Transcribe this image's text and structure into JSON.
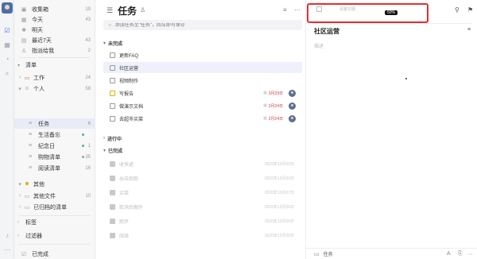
{
  "sidebar": {
    "smart_lists": [
      {
        "icon": "inbox-icon",
        "glyph": "▣",
        "label": "收集箱",
        "count": "19"
      },
      {
        "icon": "calendar-today-icon",
        "glyph": "▦",
        "label": "今天",
        "count": "43"
      },
      {
        "icon": "sun-icon",
        "glyph": "✺",
        "label": "明天",
        "count": ""
      },
      {
        "icon": "calendar-week-icon",
        "glyph": "▤",
        "label": "最近7天",
        "count": "43"
      },
      {
        "icon": "assigned-icon",
        "glyph": "♙",
        "label": "指派给我",
        "count": "2"
      }
    ],
    "lists_header": "清单",
    "folders": [
      {
        "label": "工作",
        "count": "24",
        "expanded": false,
        "icon": "folder-icon",
        "glyph": "▭"
      },
      {
        "label": "个人",
        "count": "58",
        "expanded": true,
        "icon": "person-emoji-icon",
        "glyph": "☺"
      }
    ],
    "personal_items": [
      {
        "label": "任务",
        "count": "6",
        "icon": "list-icon",
        "glyph": "≡",
        "selected": true,
        "dot": ""
      },
      {
        "label": "生活备忘",
        "count": "",
        "icon": "list-icon",
        "glyph": "≡",
        "selected": false,
        "dot": "#3fb6a8"
      },
      {
        "label": "纪念日",
        "count": "1",
        "icon": "list-icon",
        "glyph": "≡",
        "selected": false,
        "dot": "#3fb6a8"
      },
      {
        "label": "购物清单",
        "count": "35",
        "icon": "list-icon",
        "glyph": "≡",
        "selected": false,
        "dot": "#9aa0a6"
      },
      {
        "label": "阅读清单",
        "count": "16",
        "icon": "list-icon",
        "glyph": "≡",
        "selected": false,
        "dot": ""
      }
    ],
    "other_folder": {
      "label": "其他",
      "icon": "smile-emoji-icon",
      "glyph": "☻"
    },
    "other_items": [
      {
        "label": "其他文件",
        "count": "10",
        "icon": "folder-icon",
        "glyph": "▭"
      },
      {
        "label": "已归档的清单",
        "count": "",
        "icon": "archive-icon",
        "glyph": "▭"
      }
    ],
    "tags_header": "标签",
    "filters_header": "过滤器",
    "completed_label": "已完成"
  },
  "main": {
    "title": "任务",
    "add_placeholder": "添加任务至\"任务\"，回车即可保存",
    "group_todo": "未完成",
    "todo_tasks": [
      {
        "title": "更新FAQ",
        "date": "",
        "checkbox": "normal",
        "avatar": false,
        "selected": false
      },
      {
        "title": "社区运营",
        "date": "",
        "checkbox": "normal",
        "avatar": false,
        "selected": true
      },
      {
        "title": "视频制作",
        "date": "",
        "checkbox": "normal",
        "avatar": false,
        "selected": false
      },
      {
        "title": "写报告",
        "date": "3月29日",
        "checkbox": "yellow",
        "avatar": true,
        "selected": false
      },
      {
        "title": "做演示文档",
        "date": "2月24日",
        "checkbox": "normal",
        "avatar": true,
        "selected": false
      },
      {
        "title": "去超市买菜",
        "date": "2月24日",
        "checkbox": "normal",
        "avatar": true,
        "selected": false
      }
    ],
    "group_progress": "进行中",
    "group_done": "已完成",
    "done_tasks": [
      {
        "title": "收快递",
        "date": "2020年12月30日"
      },
      {
        "title": "出去跑跑",
        "date": "2020年12月30日"
      },
      {
        "title": "买菜",
        "date": "2020年12月27日"
      },
      {
        "title": "取消后额外",
        "date": "2020年12月26日"
      },
      {
        "title": "跑步",
        "date": "2020年12月26日"
      },
      {
        "title": "阅读",
        "date": "2020年12月26日"
      }
    ]
  },
  "detail": {
    "date_placeholder": "设置日期",
    "progress_text": "50%",
    "progress_fraction": 0.5,
    "title": "社区运营",
    "description_placeholder": "描述",
    "footer_list": "任务"
  },
  "colors": {
    "accent": "#4772fa",
    "highlight_box": "#e03030",
    "due_date": "#d23b3b",
    "selected_bg": "#eef1fb"
  }
}
